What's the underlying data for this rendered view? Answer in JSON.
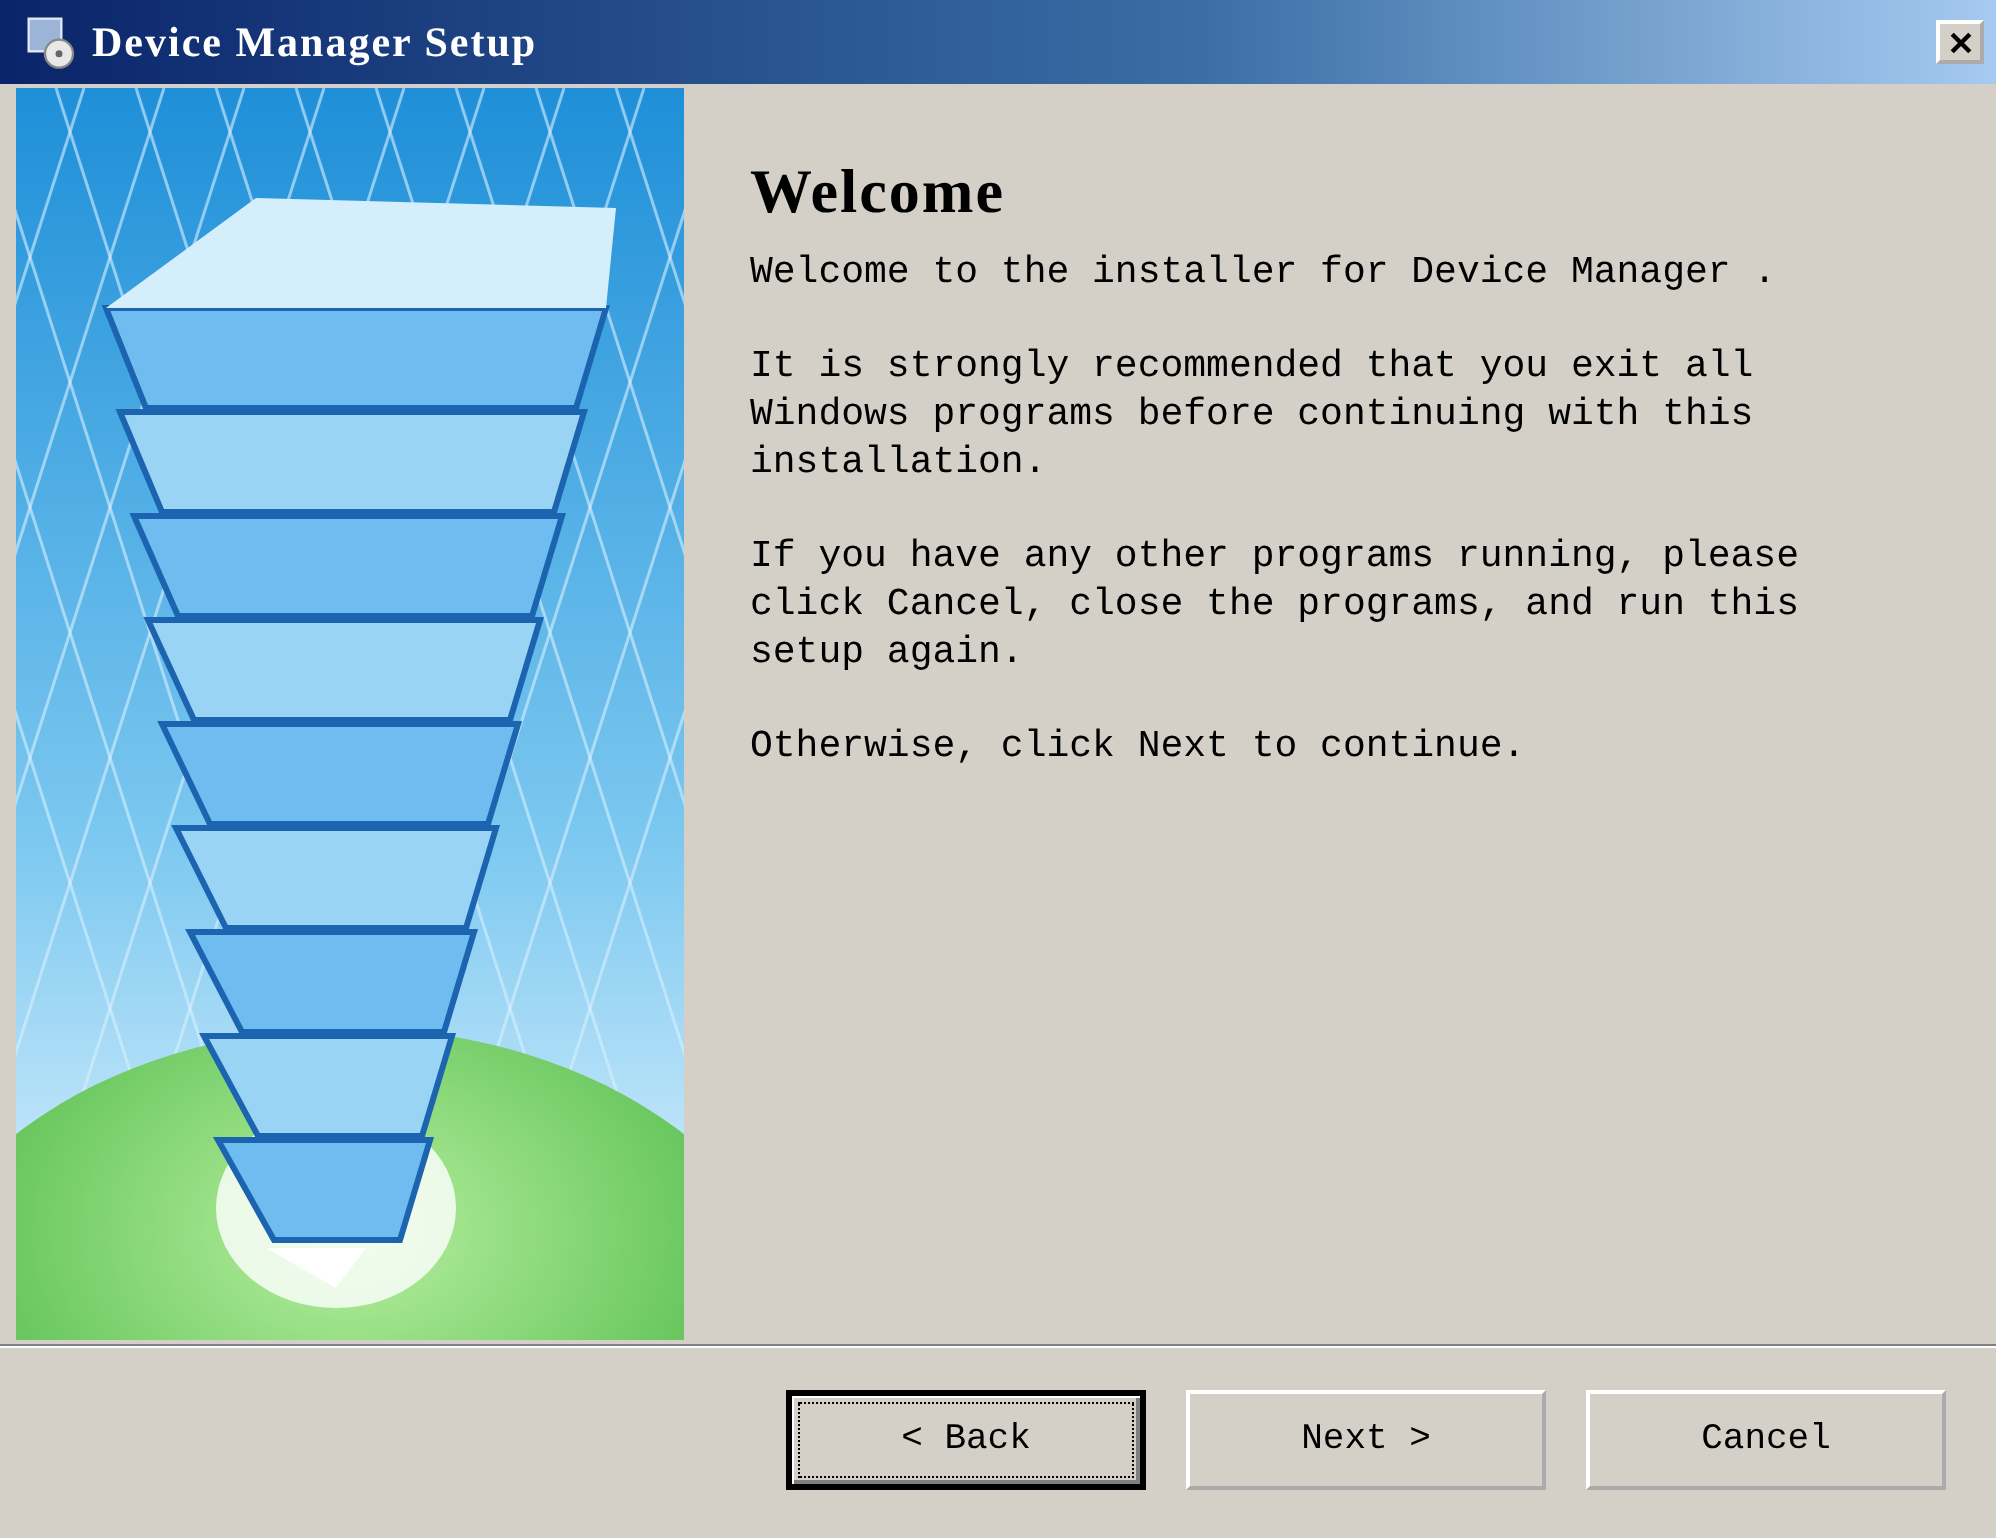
{
  "window": {
    "title": "Device Manager Setup"
  },
  "page": {
    "heading": "Welcome",
    "paragraphs": [
      "Welcome to the installer for Device Manager .",
      "It is strongly recommended that you exit all Windows programs before continuing with this installation.",
      "If you have any other programs running, please click Cancel, close the programs, and run this setup again.",
      "Otherwise, click Next to continue."
    ]
  },
  "buttons": [
    {
      "label": "< Back",
      "focused": true
    },
    {
      "label": "Next >",
      "focused": false
    },
    {
      "label": "Cancel",
      "focused": false
    }
  ]
}
